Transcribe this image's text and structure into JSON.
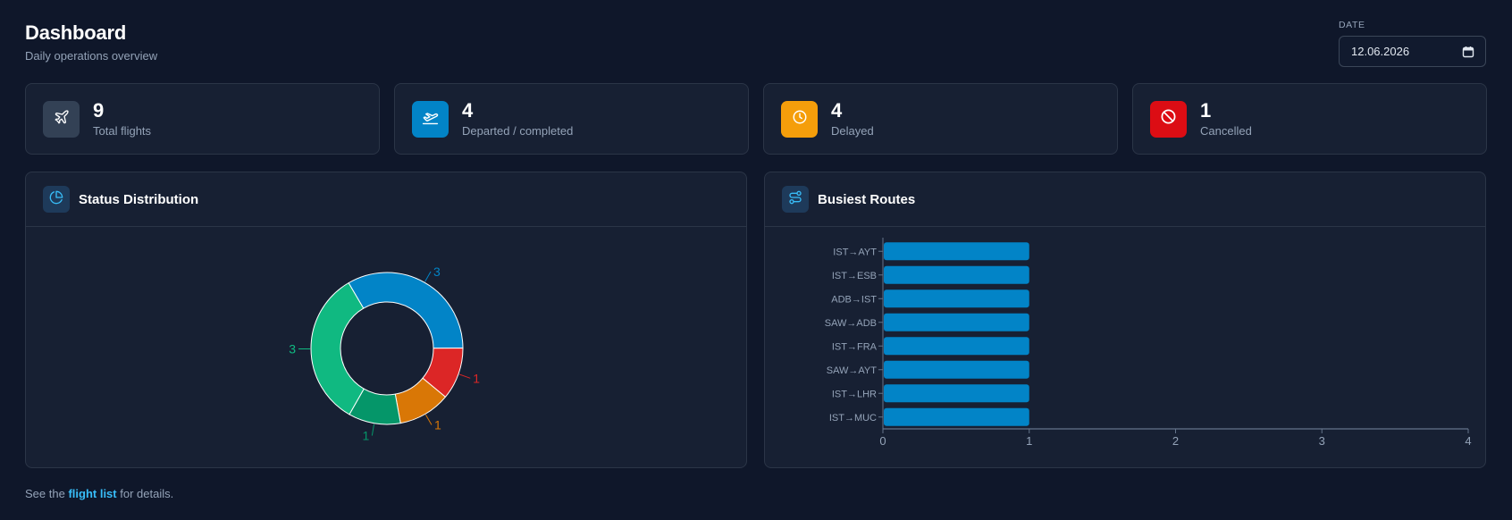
{
  "header": {
    "title": "Dashboard",
    "subtitle": "Daily operations overview"
  },
  "date": {
    "label": "DATE",
    "value": "12.06.2026"
  },
  "stats": [
    {
      "value": "9",
      "label": "Total flights",
      "icon": "plane-icon",
      "color": "#334155"
    },
    {
      "value": "4",
      "label": "Departed / completed",
      "icon": "plane-departure-icon",
      "color": "#0284c7"
    },
    {
      "value": "4",
      "label": "Delayed",
      "icon": "clock-icon",
      "color": "#f59e0b"
    },
    {
      "value": "1",
      "label": "Cancelled",
      "icon": "ban-icon",
      "color": "#dc0d14"
    }
  ],
  "status_panel": {
    "title": "Status Distribution",
    "icon": "pie-chart-icon"
  },
  "routes_panel": {
    "title": "Busiest Routes",
    "icon": "route-icon"
  },
  "chart_data": [
    {
      "type": "pie",
      "variant": "donut",
      "values": [
        3,
        1,
        1,
        1,
        3
      ],
      "colors": [
        "#0284c7",
        "#dc2626",
        "#d97706",
        "#059669",
        "#10b981"
      ],
      "labels": [
        "3",
        "1",
        "1",
        "1",
        "3"
      ],
      "legend": "none"
    },
    {
      "type": "bar",
      "orientation": "horizontal",
      "categories": [
        "IST→AYT",
        "IST→ESB",
        "ADB→IST",
        "SAW→ADB",
        "IST→FRA",
        "SAW→AYT",
        "IST→LHR",
        "IST→MUC"
      ],
      "values": [
        1,
        1,
        1,
        1,
        1,
        1,
        1,
        1
      ],
      "xlim": [
        0,
        4
      ],
      "xticks": [
        "0",
        "1",
        "2",
        "3",
        "4"
      ],
      "color": "#0284c7",
      "grid": false
    }
  ],
  "footer": {
    "prefix": "See the",
    "link": "flight list",
    "suffix": "for details."
  }
}
